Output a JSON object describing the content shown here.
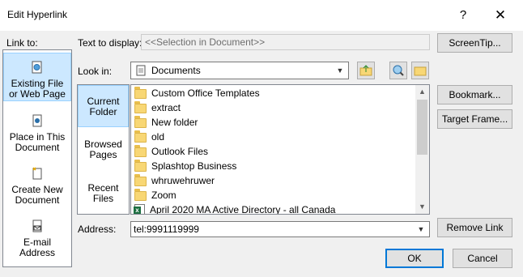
{
  "window": {
    "title": "Edit Hyperlink",
    "help_label": "?",
    "close_label": "✕"
  },
  "link_to": {
    "label": "Link to:",
    "items": [
      {
        "label_line1": "Existing File",
        "label_line2": "or Web Page",
        "icon": "globe-page-icon"
      },
      {
        "label_line1": "Place in This",
        "label_line2": "Document",
        "icon": "document-place-icon"
      },
      {
        "label_line1": "Create New",
        "label_line2": "Document",
        "icon": "new-document-icon"
      },
      {
        "label_line1": "E-mail",
        "label_line2": "Address",
        "icon": "email-icon"
      }
    ]
  },
  "text_to_display": {
    "label": "Text to display:",
    "value": "<<Selection in Document>>"
  },
  "screentip": {
    "label": "ScreenTip..."
  },
  "look_in": {
    "label": "Look in:",
    "value": "Documents"
  },
  "browse": {
    "items": [
      {
        "line1": "Current",
        "line2": "Folder"
      },
      {
        "line1": "Browsed",
        "line2": "Pages"
      },
      {
        "line1": "Recent",
        "line2": "Files"
      }
    ]
  },
  "files": [
    {
      "name": "Custom Office Templates",
      "type": "folder"
    },
    {
      "name": "extract",
      "type": "folder"
    },
    {
      "name": "New folder",
      "type": "folder"
    },
    {
      "name": "old",
      "type": "folder"
    },
    {
      "name": "Outlook Files",
      "type": "folder"
    },
    {
      "name": "Splashtop Business",
      "type": "folder"
    },
    {
      "name": "whruwehruwer",
      "type": "folder"
    },
    {
      "name": "Zoom",
      "type": "folder"
    },
    {
      "name": "April 2020 MA Active Directory - all Canada",
      "type": "excel"
    }
  ],
  "side_buttons": {
    "bookmark": "Bookmark...",
    "target_frame": "Target Frame...",
    "remove_link": "Remove Link"
  },
  "address": {
    "label": "Address:",
    "value": "tel:9991119999"
  },
  "footer": {
    "ok": "OK",
    "cancel": "Cancel"
  },
  "colors": {
    "selection": "#cce8ff",
    "accent": "#0078d7"
  }
}
